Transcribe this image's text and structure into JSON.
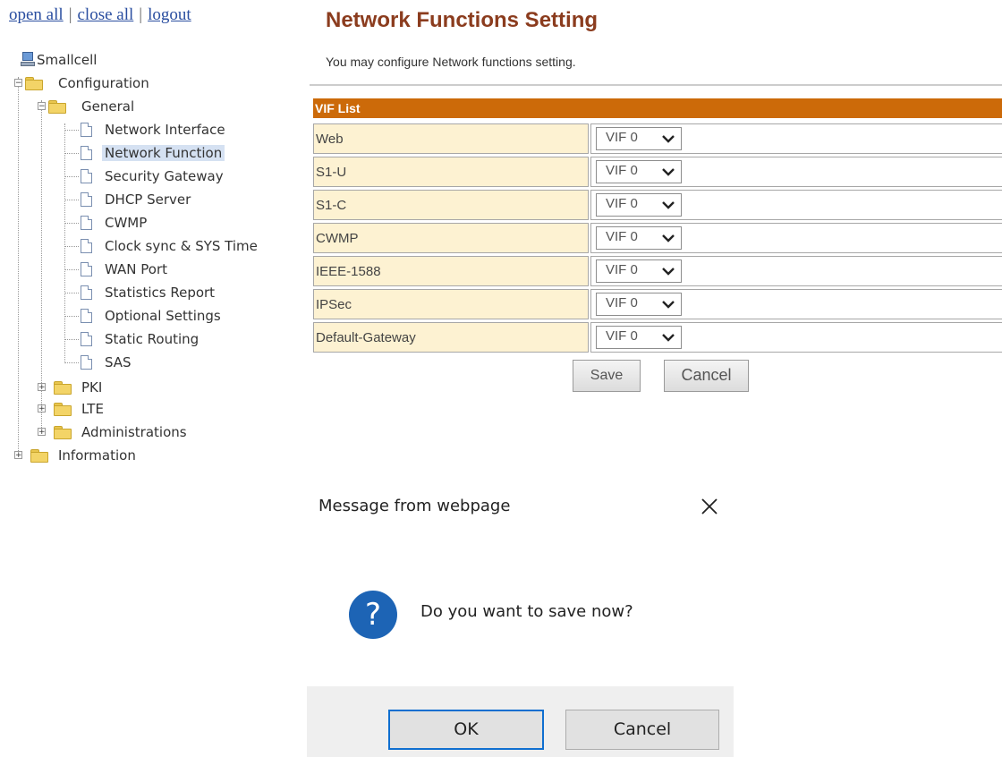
{
  "top_links": {
    "open_all": "open all",
    "close_all": "close all",
    "logout": "logout",
    "separator": "|"
  },
  "tree": {
    "root": "Smallcell",
    "configuration": "Configuration",
    "general": "General",
    "general_items": [
      "Network Interface",
      "Network Function",
      "Security Gateway",
      "DHCP Server",
      "CWMP",
      "Clock sync & SYS Time",
      "WAN Port",
      "Statistics Report",
      "Optional Settings",
      "Static Routing",
      "SAS"
    ],
    "selected_item": "Network Function",
    "pki": "PKI",
    "lte": "LTE",
    "administrations": "Administrations",
    "information": "Information",
    "expanded_marker": "−",
    "collapsed_marker": "+"
  },
  "main": {
    "title": "Network Functions Setting",
    "subtitle": "You may configure Network functions setting.",
    "list_header": "VIF List",
    "rows": [
      {
        "name": "Web",
        "value": "VIF 0"
      },
      {
        "name": "S1-U",
        "value": "VIF 0"
      },
      {
        "name": "S1-C",
        "value": "VIF 0"
      },
      {
        "name": "CWMP",
        "value": "VIF 0"
      },
      {
        "name": "IEEE-1588",
        "value": "VIF 0"
      },
      {
        "name": "IPSec",
        "value": "VIF 0"
      },
      {
        "name": "Default-Gateway",
        "value": "VIF 0"
      }
    ],
    "save_label": "Save",
    "cancel_label": "Cancel"
  },
  "dialog": {
    "title": "Message from webpage",
    "message": "Do you want to save now?",
    "icon": "question-icon",
    "icon_glyph": "?",
    "ok_label": "OK",
    "cancel_label": "Cancel",
    "close_icon": "close-icon"
  },
  "colors": {
    "title": "#8b3c1e",
    "list_header_bg": "#cc6a09",
    "row_label_bg": "#fdf2d2",
    "dialog_icon_bg": "#1d64b5",
    "ok_focus_border": "#0f6fd0"
  }
}
